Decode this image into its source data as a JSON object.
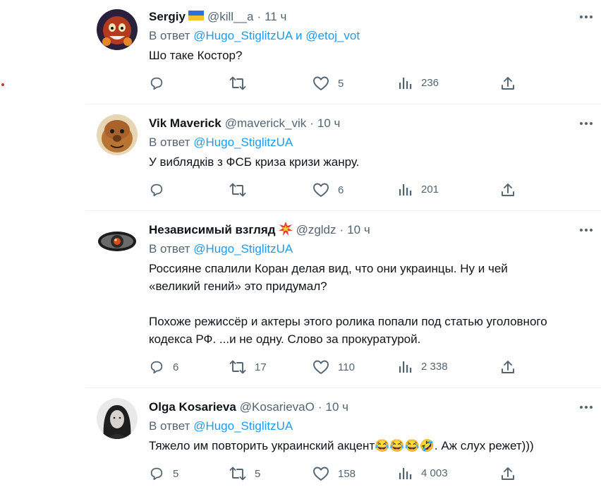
{
  "reply_prefix": "В ответ",
  "reply_and": "и",
  "tweets": [
    {
      "name": "Sergiy",
      "name_emoji": "ukraine-flag",
      "handle": "@kill__a",
      "time": "11 ч",
      "reply_to": [
        "@Hugo_StiglitzUA",
        "@etoj_vot"
      ],
      "text": "Шо таке Костор?",
      "replies": "",
      "retweets": "",
      "likes": "5",
      "views": "236"
    },
    {
      "name": "Vik Maverick",
      "handle": "@maverick_vik",
      "time": "10 ч",
      "reply_to": [
        "@Hugo_StiglitzUA"
      ],
      "text": "У виблядків з ФСБ криза кризи жанру.",
      "replies": "",
      "retweets": "",
      "likes": "6",
      "views": "201"
    },
    {
      "name": "Независимый взгляд",
      "name_emoji": "collision",
      "handle": "@zgldz",
      "time": "10 ч",
      "reply_to": [
        "@Hugo_StiglitzUA"
      ],
      "text": "Россияне спалили Коран делая вид, что они украинцы. Ну и чей\n«великий гений» это придумал?\n\nПохоже режиссёр и актеры этого ролика попали под статью уголовного\nкодекса РФ. ...и не одну. Слово за прокуратурой.",
      "replies": "6",
      "retweets": "17",
      "likes": "110",
      "views": "2 338"
    },
    {
      "name": "Olga Kosarieva",
      "handle": "@KosarievaO",
      "time": "10 ч",
      "reply_to": [
        "@Hugo_StiglitzUA"
      ],
      "text": "Тяжело им повторить украинский акцент😂😂😂🤣. Аж слух режет)))",
      "replies": "5",
      "retweets": "5",
      "likes": "158",
      "views": "4 003"
    }
  ],
  "colors": {
    "text": "#0f1419",
    "secondary": "#536471",
    "link": "#1d9bf0",
    "divider": "#eff3f4"
  },
  "icons": [
    "reply-icon",
    "retweet-icon",
    "like-icon",
    "views-icon",
    "share-icon",
    "more-icon"
  ]
}
